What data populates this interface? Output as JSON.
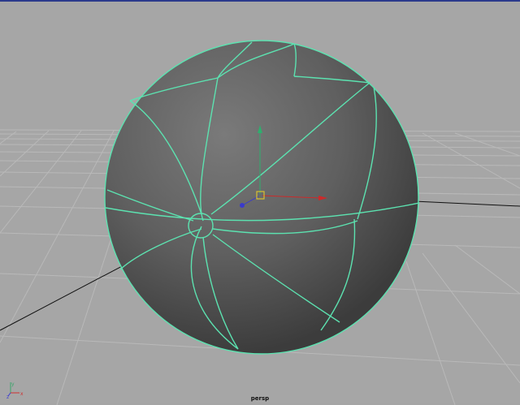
{
  "viewport": {
    "camera_label": "persp",
    "background_color": "#a6a6a6",
    "grid_color": "#bcbcbc",
    "wireframe_color": "#5ce2b0"
  },
  "axis_indicator": {
    "x_label": "x",
    "y_label": "y",
    "z_label": "z",
    "x_color": "#d03030",
    "y_color": "#3aa56a",
    "z_color": "#3c3cd0"
  },
  "manipulator": {
    "x_color": "#cc2a2a",
    "y_color": "#2fae6e",
    "z_color": "#3a3acc",
    "center_color": "#d8c030"
  }
}
